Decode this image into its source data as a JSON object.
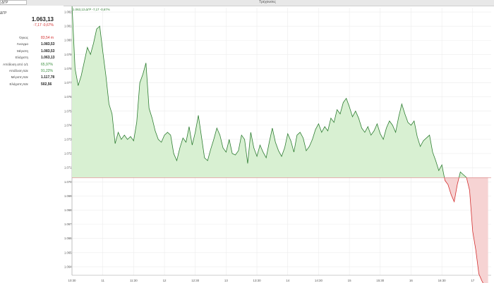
{
  "header": {
    "ticker_input": "ΔΓΡ",
    "title": "Τρέχουσες"
  },
  "left_panel": {
    "ticker": "ΔΓΡ",
    "price": "1.063,13",
    "change": "-7,17  -0,67%",
    "stats": [
      {
        "label": "Όγκος",
        "value": "83,54 m",
        "tone": "neg"
      },
      {
        "label": "Άνοιγμα",
        "value": "1.083,53",
        "tone": "normal"
      },
      {
        "label": "Μέγιστη",
        "value": "1.083,53",
        "tone": "normal"
      },
      {
        "label": "Ελάχιστη",
        "value": "1.063,13",
        "tone": "normal"
      },
      {
        "label": "Απόδοση από 1/1",
        "value": "65,97%",
        "tone": "pos"
      },
      {
        "label": "Απόδοση 52ε",
        "value": "91,22%",
        "tone": "pos"
      },
      {
        "label": "Μέγιστη 52ε",
        "value": "1.117,78",
        "tone": "normal"
      },
      {
        "label": "Ελάχιστη 52ε",
        "value": "502,56",
        "tone": "normal"
      }
    ]
  },
  "colors": {
    "up_line": "#2e7d32",
    "up_fill": "#d8f0d2",
    "down_line": "#d32f2f",
    "down_fill": "#f6d3d3",
    "baseline": "#d88080"
  },
  "chart_data": {
    "type": "area",
    "legend": "1.063,13 ΔΓΡ -7,17 -0,67%",
    "baseline": 1070.3,
    "ylim": [
      1063.4,
      1082.3
    ],
    "y_ticks": [
      1082,
      1081,
      1080,
      1079,
      1078,
      1077,
      1076,
      1075,
      1074,
      1073,
      1072,
      1071,
      1070,
      1069,
      1068,
      1067,
      1066,
      1065,
      1064
    ],
    "y_tick_labels": [
      "1.082",
      "1.081",
      "1.080",
      "1.079",
      "1.078",
      "1.077",
      "1.076",
      "1.075",
      "1.074",
      "1.073",
      "1.072",
      "1.071",
      "1.070",
      "1.069",
      "1.068",
      "1.067",
      "1.066",
      "1.065",
      "1.064"
    ],
    "xlim": [
      10.5,
      17.3
    ],
    "x_ticks": [
      10.5,
      11,
      11.5,
      12,
      12.5,
      13,
      13.5,
      14,
      14.5,
      15,
      15.5,
      16,
      16.5,
      17
    ],
    "x_tick_labels": [
      "10:30",
      "11",
      "11:30",
      "12",
      "12:30",
      "13",
      "13:30",
      "14",
      "14:30",
      "15",
      "15:30",
      "16",
      "16:30",
      "17"
    ],
    "x": [
      10.5,
      10.55,
      10.6,
      10.65,
      10.7,
      10.75,
      10.8,
      10.85,
      10.9,
      10.95,
      11.0,
      11.05,
      11.1,
      11.15,
      11.2,
      11.25,
      11.3,
      11.35,
      11.4,
      11.45,
      11.5,
      11.55,
      11.6,
      11.65,
      11.7,
      11.75,
      11.8,
      11.85,
      11.9,
      11.95,
      12.0,
      12.05,
      12.1,
      12.15,
      12.2,
      12.25,
      12.3,
      12.35,
      12.4,
      12.45,
      12.5,
      12.55,
      12.6,
      12.65,
      12.7,
      12.75,
      12.8,
      12.85,
      12.9,
      12.95,
      13.0,
      13.05,
      13.1,
      13.15,
      13.2,
      13.25,
      13.3,
      13.35,
      13.4,
      13.45,
      13.5,
      13.55,
      13.6,
      13.65,
      13.7,
      13.75,
      13.8,
      13.85,
      13.9,
      13.95,
      14.0,
      14.05,
      14.1,
      14.15,
      14.2,
      14.25,
      14.3,
      14.35,
      14.4,
      14.45,
      14.5,
      14.55,
      14.6,
      14.65,
      14.7,
      14.75,
      14.8,
      14.85,
      14.9,
      14.95,
      15.0,
      15.05,
      15.1,
      15.15,
      15.2,
      15.25,
      15.3,
      15.35,
      15.4,
      15.45,
      15.5,
      15.55,
      15.6,
      15.65,
      15.7,
      15.75,
      15.8,
      15.85,
      15.9,
      15.95,
      16.0,
      16.05,
      16.1,
      16.15,
      16.2,
      16.25,
      16.3,
      16.35,
      16.4,
      16.45,
      16.5,
      16.55,
      16.6,
      16.65,
      16.7,
      16.75,
      16.8,
      16.85,
      16.9,
      16.95,
      17.0,
      17.05,
      17.1,
      17.15,
      17.2,
      17.25
    ],
    "values": [
      1082.5,
      1078.0,
      1076.8,
      1077.5,
      1078.5,
      1079.5,
      1079.0,
      1079.8,
      1080.8,
      1081.0,
      1079.2,
      1077.5,
      1075.5,
      1074.8,
      1072.7,
      1073.5,
      1073.0,
      1073.3,
      1073.0,
      1073.2,
      1072.9,
      1074.2,
      1077.0,
      1077.6,
      1078.4,
      1075.2,
      1074.5,
      1073.6,
      1073.0,
      1072.8,
      1073.3,
      1073.5,
      1073.3,
      1072.0,
      1071.5,
      1072.4,
      1073.1,
      1072.8,
      1073.9,
      1072.6,
      1073.5,
      1074.7,
      1073.2,
      1071.7,
      1071.5,
      1072.3,
      1073.0,
      1073.8,
      1073.3,
      1072.4,
      1072.1,
      1073.0,
      1072.0,
      1071.9,
      1072.2,
      1073.3,
      1073.0,
      1071.3,
      1073.5,
      1072.4,
      1071.8,
      1072.6,
      1072.1,
      1071.7,
      1072.8,
      1073.8,
      1072.8,
      1072.2,
      1071.8,
      1072.4,
      1073.4,
      1072.9,
      1072.1,
      1073.3,
      1073.5,
      1073.1,
      1072.2,
      1072.5,
      1073.0,
      1073.7,
      1074.1,
      1073.5,
      1073.9,
      1073.6,
      1074.5,
      1074.2,
      1075.1,
      1074.8,
      1075.6,
      1075.9,
      1075.3,
      1074.6,
      1075.0,
      1074.5,
      1073.8,
      1073.5,
      1073.9,
      1073.3,
      1073.6,
      1074.1,
      1073.4,
      1073.0,
      1073.8,
      1074.3,
      1074.0,
      1073.5,
      1074.6,
      1075.5,
      1074.8,
      1074.2,
      1074.0,
      1074.3,
      1073.2,
      1072.5,
      1072.9,
      1073.1,
      1073.3,
      1072.1,
      1071.5,
      1070.8,
      1071.2,
      1070.1,
      1069.8,
      1069.1,
      1068.6,
      1069.8,
      1070.7,
      1070.5,
      1070.3,
      1069.4,
      1066.5,
      1065.2,
      1063.5,
      1063.0,
      1062.6,
      1062.4
    ]
  }
}
